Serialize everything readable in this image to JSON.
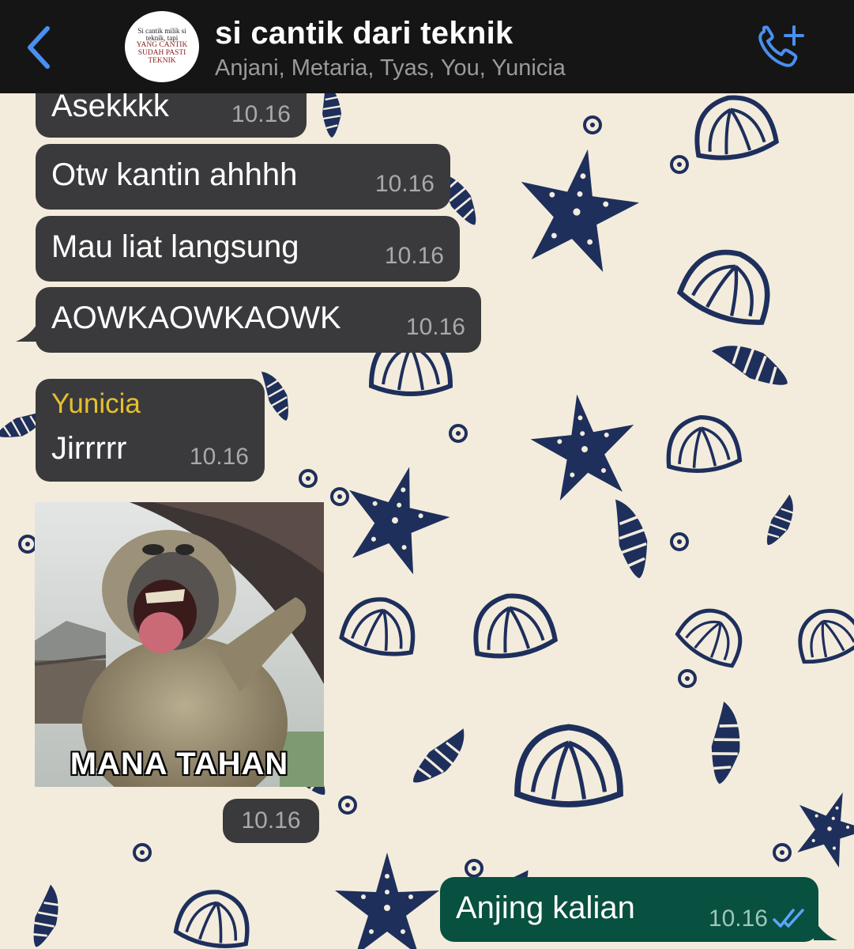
{
  "header": {
    "title": "si cantik dari teknik",
    "participants": "Anjani, Metaria, Tyas, You, Yunicia",
    "avatar_lines": [
      "Si cantik milik si",
      "teknik, tapi",
      "YANG CANTIK",
      "SUDAH PASTI",
      "TEKNIK"
    ],
    "back_icon": "chevron-left-icon",
    "call_icon": "add-call-icon"
  },
  "messages": [
    {
      "text": "Asekkkk",
      "time": "10.16"
    },
    {
      "text": "Otw kantin ahhhh",
      "time": "10.16"
    },
    {
      "text": "Mau liat langsung",
      "time": "10.16"
    },
    {
      "text": "AOWKAOWKAOWK",
      "time": "10.16"
    },
    {
      "sender": "Yunicia",
      "text": "Jirrrrr",
      "time": "10.16"
    }
  ],
  "sticker": {
    "caption": "MANA TAHAN",
    "time": "10.16"
  },
  "sent_message": {
    "text": "Anjing kalian",
    "time": "10.16",
    "status_icon": "double-check-read-icon"
  },
  "colors": {
    "header_bg": "#151515",
    "accent_blue": "#4a8ff0",
    "incoming_bubble": "#3a3a3c",
    "outgoing_bubble": "#08503f",
    "sender_name": "#e6c02c",
    "wallpaper_bg": "#f3ecdc",
    "wallpaper_ink": "#1e2f5c"
  }
}
